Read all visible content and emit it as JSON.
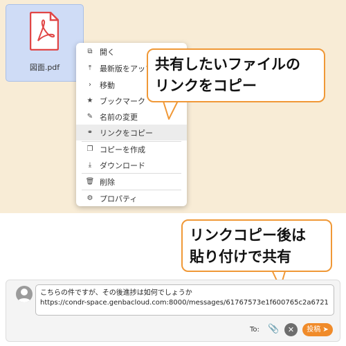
{
  "file": {
    "name": "図面.pdf",
    "icon": "pdf-file-icon"
  },
  "context_menu": {
    "items": [
      {
        "icon": "external-link-icon",
        "label": "開く"
      },
      {
        "icon": "upload-icon",
        "label": "最新版をアップ"
      },
      {
        "icon": "chevron-right-icon",
        "label": "移動"
      },
      {
        "icon": "star-icon",
        "label": "ブックマーク"
      },
      {
        "icon": "pencil-icon",
        "label": "名前の変更"
      },
      {
        "icon": "link-icon",
        "label": "リンクをコピー",
        "highlighted": true
      },
      {
        "icon": "copy-icon",
        "label": "コピーを作成"
      },
      {
        "icon": "download-icon",
        "label": "ダウンロード"
      },
      {
        "icon": "trash-icon",
        "label": "削除"
      },
      {
        "icon": "gear-icon",
        "label": "プロパティ"
      }
    ]
  },
  "callouts": {
    "top_line1": "共有したいファイルの",
    "top_line2": "リンクをコピー",
    "bottom_line1": "リンクコピー後は",
    "bottom_line2": "貼り付けで共有"
  },
  "composer": {
    "line1": "こちらの件ですが、その後進捗は如何でしょうか",
    "line2": "https://condr-space.genbacloud.com:8000/messages/61767573e1f600765c2a6721",
    "to_label": "To:",
    "post_label": "投稿",
    "icons": [
      "avatar-icon",
      "paperclip-icon",
      "close-icon",
      "send-icon"
    ]
  },
  "colors": {
    "accent": "#f09836",
    "background_top": "#f8ecd6",
    "pdf_red": "#e04646"
  }
}
